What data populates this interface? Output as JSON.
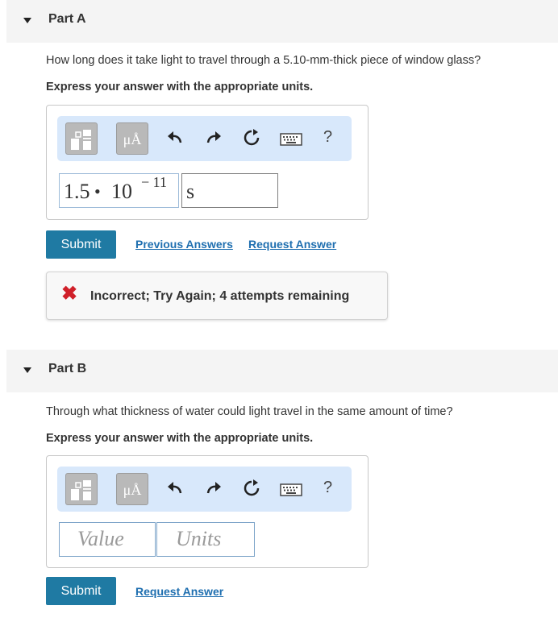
{
  "partA": {
    "title": "Part A",
    "question": "How long does it take light to travel through a 5.10-mm-thick piece of window glass?",
    "instruction": "Express your answer with the appropriate units.",
    "toolbar": {
      "unit_button_label": "μÅ",
      "help_label": "?"
    },
    "answer": {
      "mantissa": "1.5",
      "times": "•",
      "base": "10",
      "exponent": "− 11",
      "units": "s"
    },
    "submit_label": "Submit",
    "previous_answers_label": "Previous Answers",
    "request_answer_label": "Request Answer",
    "feedback": "Incorrect; Try Again; 4 attempts remaining",
    "feedback_icon": "✖"
  },
  "partB": {
    "title": "Part B",
    "question": "Through what thickness of water could light travel in the same amount of time?",
    "instruction": "Express your answer with the appropriate units.",
    "toolbar": {
      "unit_button_label": "μÅ",
      "help_label": "?"
    },
    "value_placeholder": "Value",
    "units_placeholder": "Units",
    "submit_label": "Submit",
    "request_answer_label": "Request Answer"
  },
  "colors": {
    "accent": "#1f7aa3",
    "link": "#1f6fb0",
    "error": "#d0202a",
    "toolbar_bg": "#d8e8fb"
  }
}
